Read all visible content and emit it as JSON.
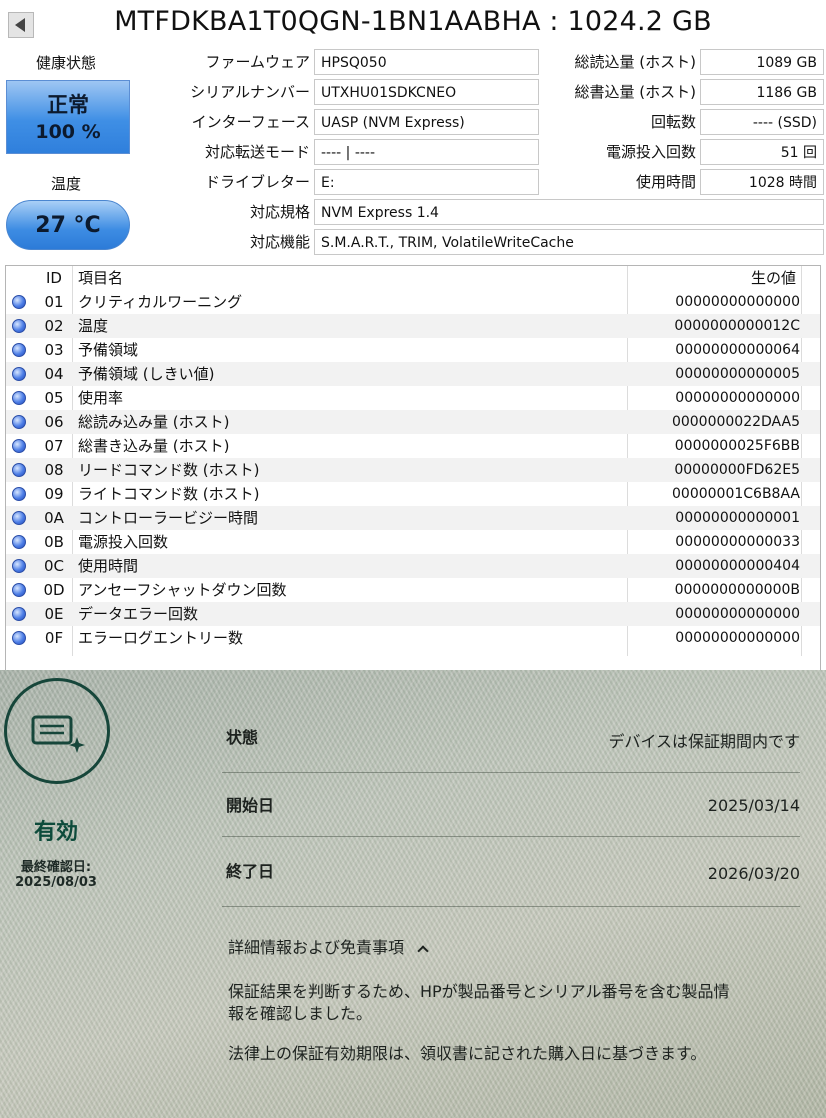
{
  "header": {
    "title": "MTFDKBA1T0QGN-1BN1AABHA : 1024.2 GB"
  },
  "health": {
    "label": "健康状態",
    "status": "正常",
    "percent": "100 %",
    "temp_label": "温度",
    "temp": "27 °C"
  },
  "info_left": [
    {
      "label": "ファームウェア",
      "value": "HPSQ050"
    },
    {
      "label": "シリアルナンバー",
      "value": "UTXHU01SDKCNEO"
    },
    {
      "label": "インターフェース",
      "value": "UASP (NVM Express)"
    },
    {
      "label": "対応転送モード",
      "value": "---- | ----"
    },
    {
      "label": "ドライブレター",
      "value": "E:"
    },
    {
      "label": "対応規格",
      "value": "NVM Express 1.4"
    },
    {
      "label": "対応機能",
      "value": "S.M.A.R.T., TRIM, VolatileWriteCache"
    }
  ],
  "info_right": [
    {
      "label": "総読込量 (ホスト)",
      "value": "1089 GB"
    },
    {
      "label": "総書込量 (ホスト)",
      "value": "1186 GB"
    },
    {
      "label": "回転数",
      "value": "---- (SSD)"
    },
    {
      "label": "電源投入回数",
      "value": "51 回"
    },
    {
      "label": "使用時間",
      "value": "1028 時間"
    }
  ],
  "smart": {
    "headers": {
      "id": "ID",
      "name": "項目名",
      "raw": "生の値"
    },
    "rows": [
      {
        "id": "01",
        "name": "クリティカルワーニング",
        "raw": "00000000000000"
      },
      {
        "id": "02",
        "name": "温度",
        "raw": "0000000000012C"
      },
      {
        "id": "03",
        "name": "予備領域",
        "raw": "00000000000064"
      },
      {
        "id": "04",
        "name": "予備領域 (しきい値)",
        "raw": "00000000000005"
      },
      {
        "id": "05",
        "name": "使用率",
        "raw": "00000000000000"
      },
      {
        "id": "06",
        "name": "総読み込み量 (ホスト)",
        "raw": "0000000022DAA5"
      },
      {
        "id": "07",
        "name": "総書き込み量 (ホスト)",
        "raw": "0000000025F6BB"
      },
      {
        "id": "08",
        "name": "リードコマンド数 (ホスト)",
        "raw": "00000000FD62E5"
      },
      {
        "id": "09",
        "name": "ライトコマンド数 (ホスト)",
        "raw": "00000001C6B8AA"
      },
      {
        "id": "0A",
        "name": "コントローラービジー時間",
        "raw": "00000000000001"
      },
      {
        "id": "0B",
        "name": "電源投入回数",
        "raw": "00000000000033"
      },
      {
        "id": "0C",
        "name": "使用時間",
        "raw": "00000000000404"
      },
      {
        "id": "0D",
        "name": "アンセーフシャットダウン回数",
        "raw": "0000000000000B"
      },
      {
        "id": "0E",
        "name": "データエラー回数",
        "raw": "00000000000000"
      },
      {
        "id": "0F",
        "name": "エラーログエントリー数",
        "raw": "00000000000000"
      }
    ]
  },
  "warranty": {
    "status": "有効",
    "last_checked_label": "最終確認日:",
    "last_checked": "2025/08/03",
    "state_label": "状態",
    "state_value": "デバイスは保証期間内です",
    "start_label": "開始日",
    "start_value": "2025/03/14",
    "end_label": "終了日",
    "end_value": "2026/03/20",
    "details_label": "詳細情報および免責事項",
    "details_text_1": "保証結果を判断するため、HPが製品番号とシリアル番号を含む製品情",
    "details_text_2": "報を確認しました。",
    "details_text_3": "法律上の保証有効期限は、領収書に記された購入日に基づきます。"
  },
  "colors": {
    "health_blue": "#3f8fe5",
    "hp_green": "#0d4b3b"
  }
}
